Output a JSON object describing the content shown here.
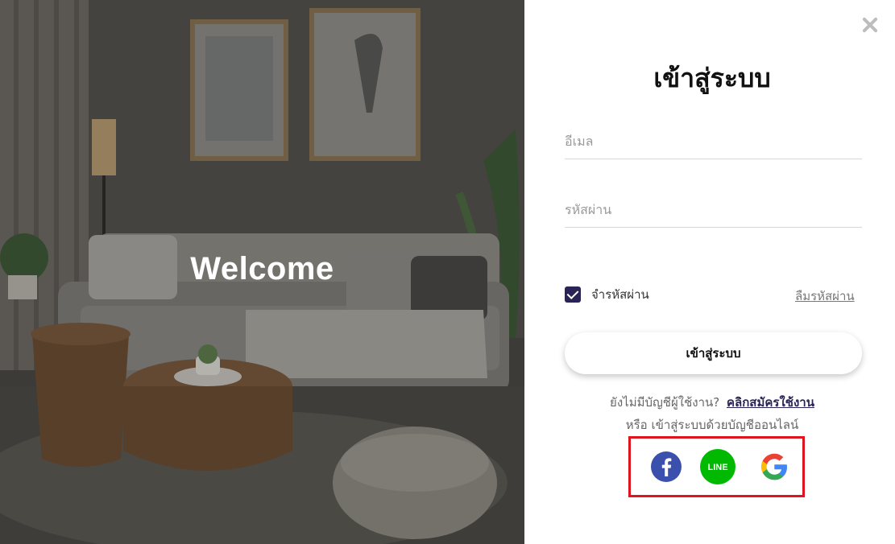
{
  "hero": {
    "welcome_text": "Welcome"
  },
  "login": {
    "title": "เข้าสู่ระบบ",
    "email_placeholder": "อีเมล",
    "password_placeholder": "รหัสผ่าน",
    "remember_label": "จำรหัสผ่าน",
    "remember_checked": true,
    "forgot_label": "ลืมรหัสผ่าน",
    "submit_label": "เข้าสู่ระบบ",
    "no_account_text": "ยังไม่มีบัญชีผู้ใช้งาน?",
    "signup_label": "คลิกสมัครใช้งาน",
    "or_social_text": "หรือ เข้าสู่ระบบด้วยบัญชีออนไลน์"
  },
  "social": {
    "facebook": {
      "icon": "facebook-icon",
      "color": "#3b4fad"
    },
    "line": {
      "icon": "line-icon",
      "label": "LINE",
      "color": "#00b900"
    },
    "google": {
      "icon": "google-icon"
    },
    "highlight_color": "#e0141e"
  },
  "colors": {
    "accent": "#2a2456"
  }
}
